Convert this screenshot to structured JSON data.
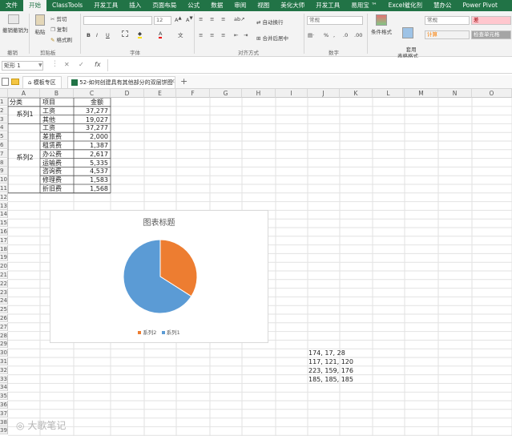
{
  "menu": [
    "文件",
    "开始",
    "ClassTools",
    "开发工具",
    "插入",
    "页面布局",
    "公式",
    "数据",
    "审阅",
    "视图",
    "美化大师",
    "开发工具",
    "易用宝 ™",
    "Excel催化剂",
    "慧办公",
    "Power Pivot"
  ],
  "ribbon": {
    "paste": "粘贴",
    "cut": "剪切",
    "copy": "复制",
    "format_painter": "格式刷",
    "clipboard_group": "剪贴板",
    "font_group": "字体",
    "align_group": "对齐方式",
    "number_group": "数字",
    "undo_group": "撤销",
    "font_size": "12",
    "wrap_text": "自动换行",
    "merge_center": "合并后居中",
    "number_format": "常规",
    "cond_format": "条件格式",
    "table_format": "套用\n表格格式",
    "style_normal": "常规",
    "style_bad": "差",
    "style_calc": "计算",
    "style_check": "检查单元格",
    "undo_label": "撤销撤销为"
  },
  "formula_bar": {
    "name_box": "矩形 1",
    "fx": "fx",
    "cancel": "✕",
    "enter": "✓"
  },
  "tabs": {
    "template": "模板专区",
    "file": "52-如何创建具有其他部分的双层饼图"
  },
  "columns": [
    "A",
    "B",
    "C",
    "D",
    "E",
    "F",
    "G",
    "H",
    "I",
    "J",
    "K",
    "L",
    "M",
    "N",
    "O"
  ],
  "table": {
    "headers": [
      "分类",
      "项目",
      "金额"
    ],
    "group1": "系列1",
    "group2": "系列2",
    "rows": [
      [
        "工资",
        "37,277"
      ],
      [
        "其他",
        "19,027"
      ],
      [
        "工资",
        "37,277"
      ],
      [
        "差旅费",
        "2,000"
      ],
      [
        "租赁费",
        "1,387"
      ],
      [
        "办公费",
        "2,617"
      ],
      [
        "运输费",
        "5,335"
      ],
      [
        "咨询费",
        "4,537"
      ],
      [
        "修理费",
        "1,583"
      ],
      [
        "折旧费",
        "1,568"
      ]
    ]
  },
  "rgb_notes": [
    "174, 17, 28",
    "117, 121, 120",
    "223, 159, 176",
    "185, 185, 185"
  ],
  "watermark": "大歌笔记",
  "colors": {
    "series1": "#5b9bd5",
    "series2": "#ed7d31",
    "excel_green": "#217346"
  },
  "chart_data": {
    "type": "pie",
    "title": "图表标题",
    "categories": [
      "系列2",
      "系列1"
    ],
    "values": [
      34,
      66
    ],
    "legend": [
      "系列2",
      "系列1"
    ],
    "legend_position": "bottom"
  }
}
